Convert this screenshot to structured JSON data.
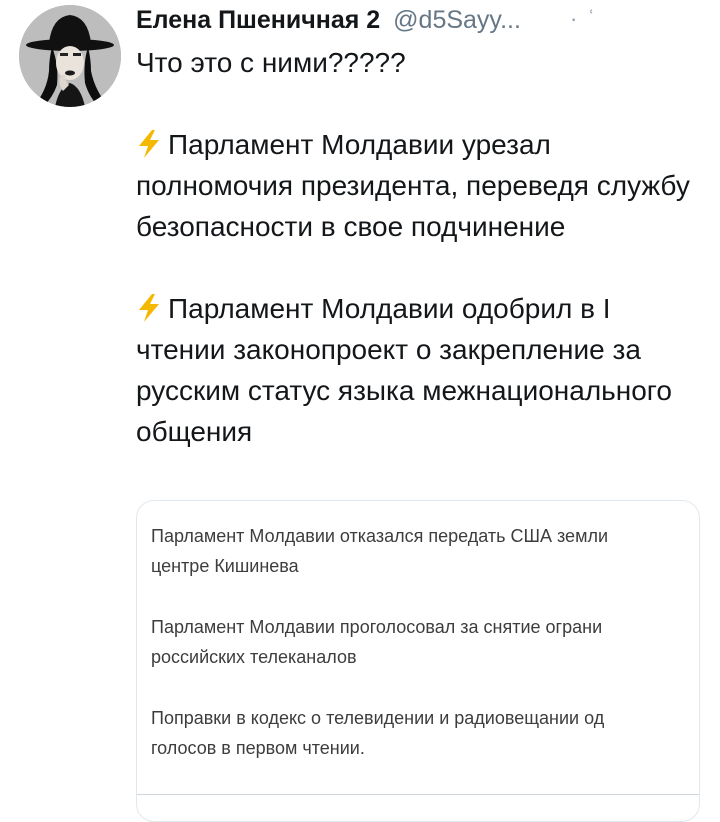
{
  "tweet": {
    "display_name": "Елена Пшеничная 2",
    "handle": "@d5Sayy...",
    "more_symbol": "· ʿ",
    "intro": "Что это с ними?????",
    "items": [
      {
        "icon": "lightning-bolt-icon",
        "text": "Парламент Молдавии урезал полномочия президента, переведя службу безопасности в свое подчинение"
      },
      {
        "icon": "lightning-bolt-icon",
        "text": "Парламент Молдавии одобрил в I чтении законопроект о закрепление за русским статус языка межнационального общения"
      }
    ],
    "colors": {
      "text": "#14171a",
      "secondary": "#657786",
      "bolt": "#f5b800",
      "border": "#e1e8ed"
    }
  },
  "card": {
    "news": [
      {
        "line1": "Парламент Молдавии отказался передать США земли",
        "line2": "центре Кишинева"
      },
      {
        "line1": "Парламент Молдавии проголосовал за снятие ограни",
        "line2": "российских телеканалов"
      },
      {
        "line1": "Поправки в кодекс о телевидении и радиовещании од",
        "line2": "голосов в первом чтении."
      }
    ]
  }
}
